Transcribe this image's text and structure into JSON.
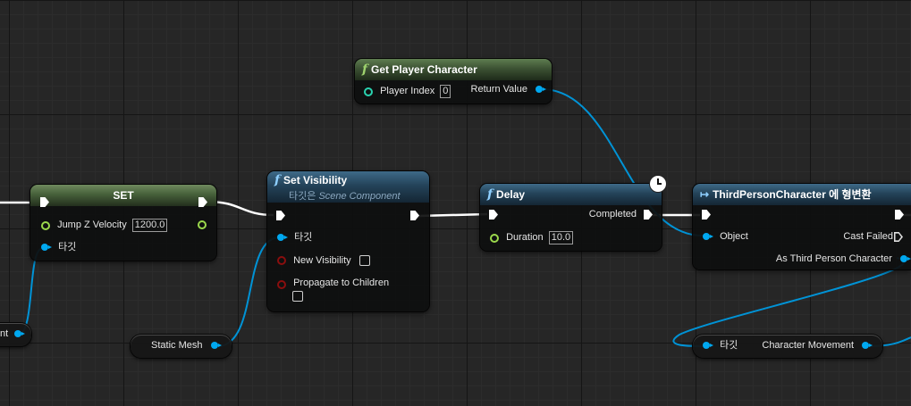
{
  "nodes": {
    "get_player_character": {
      "title": "Get Player Character",
      "pin_player_index": "Player Index",
      "player_index_value": "0",
      "pin_return_value": "Return Value"
    },
    "set": {
      "title": "SET",
      "pin_jump_z_velocity": "Jump Z Velocity",
      "jump_z_velocity_value": "1200.0",
      "pin_target": "타깃"
    },
    "set_visibility": {
      "title": "Set Visibility",
      "subtitle_prefix": "타깃은",
      "subtitle_class": "Scene Component",
      "pin_target": "타깃",
      "pin_new_visibility": "New Visibility",
      "pin_propagate": "Propagate to Children"
    },
    "delay": {
      "title": "Delay",
      "pin_completed": "Completed",
      "pin_duration": "Duration",
      "duration_value": "10.0"
    },
    "cast": {
      "title": "ThirdPersonCharacter 에 형변환",
      "pin_object": "Object",
      "pin_cast_failed": "Cast Failed",
      "pin_as": "As Third Person Character"
    },
    "static_mesh": {
      "label": "Static Mesh"
    },
    "character_movement": {
      "target_label": "타깃",
      "label": "Character Movement"
    },
    "left_partial": {
      "label": "nt"
    }
  },
  "colors": {
    "exec_wire": "#ffffff",
    "object_pin": "#00a8f0",
    "float_pin": "#9bd84c",
    "bool_pin": "#8a0e0e",
    "int_pin": "#2ad3b0",
    "function_header_green": "#3c5233",
    "function_header_blue": "#244359"
  },
  "icons": {
    "function": "function-icon",
    "latent": "clock-icon",
    "cast": "cast-icon"
  }
}
